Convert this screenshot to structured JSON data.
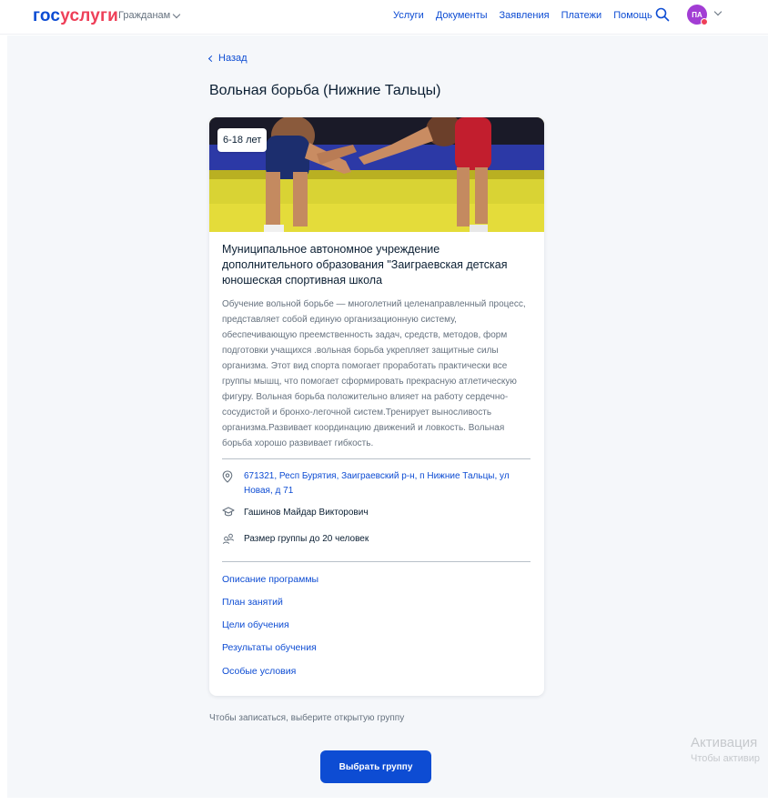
{
  "header": {
    "logo_part1": "гос",
    "logo_part2": "услуги",
    "audience": "Гражданам",
    "nav": [
      "Услуги",
      "Документы",
      "Заявления",
      "Платежи",
      "Помощь"
    ],
    "avatar_initials": "ПА"
  },
  "page": {
    "back_label": "Назад",
    "title": "Вольная борьба (Нижние Тальцы)"
  },
  "card": {
    "age_badge": "6-18 лет",
    "organization": "Муниципальное автономное учреждение дополнительного образования \"Заиграевская детская юношеская спортивная школа",
    "description": "Обучение вольной борьбе — многолетний целенаправленный процесс, представляет собой единую организационную систему, обеспечивающую преемственность задач, средств, методов, форм подготовки учащихся .вольная борьба укрепляет защитные силы организма. Этот вид спорта помогает проработать практически все группы мышц, что помогает сформировать прекрасную атлетическую фигуру. Вольная борьба положительно влияет на работу сердечно-сосудистой и бронхо-легочной систем.Тренирует выносливость организма.Развивает координацию движений и ловкость. Вольная борьба хорошо развивает гибкость.",
    "address": "671321, Респ Бурятия, Заиграевский р-н, п Нижние Тальцы, ул Новая, д 71",
    "teacher": "Гашинов Майдар Викторович",
    "group_size": "Размер группы до 20 человек",
    "links": [
      "Описание программы",
      "План занятий",
      "Цели обучения",
      "Результаты обучения",
      "Особые условия"
    ]
  },
  "footer": {
    "hint": "Чтобы записаться, выберите открытую группу",
    "select_button": "Выбрать группу"
  },
  "watermark": {
    "line1": "Активация",
    "line2": "Чтобы активир"
  },
  "colors": {
    "brand_blue": "#0d4cd3",
    "brand_red": "#ee3f58",
    "avatar_purple": "#a23dd4",
    "page_background": "#f5f7fa"
  }
}
